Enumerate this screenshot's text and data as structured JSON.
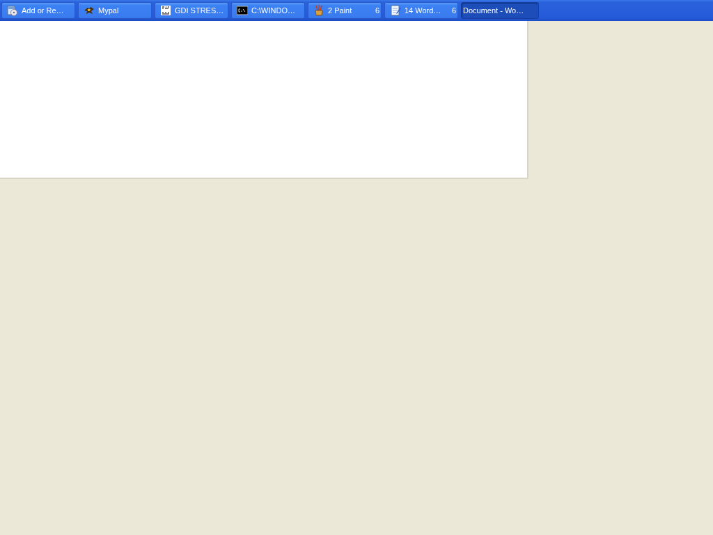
{
  "taskbar": {
    "buttons": [
      {
        "label": "Add or Re…",
        "selected": false
      },
      {
        "label": "Mypal",
        "selected": false
      },
      {
        "label": "GDI STRES…",
        "selected": false
      },
      {
        "label": "C:\\WINDO…",
        "selected": false
      },
      {
        "label": "2 Paint",
        "count": "6",
        "selected": false
      },
      {
        "label": "14 Word…",
        "count": "6",
        "selected": false
      },
      {
        "label": "Document - Wo…",
        "selected": true
      }
    ]
  }
}
